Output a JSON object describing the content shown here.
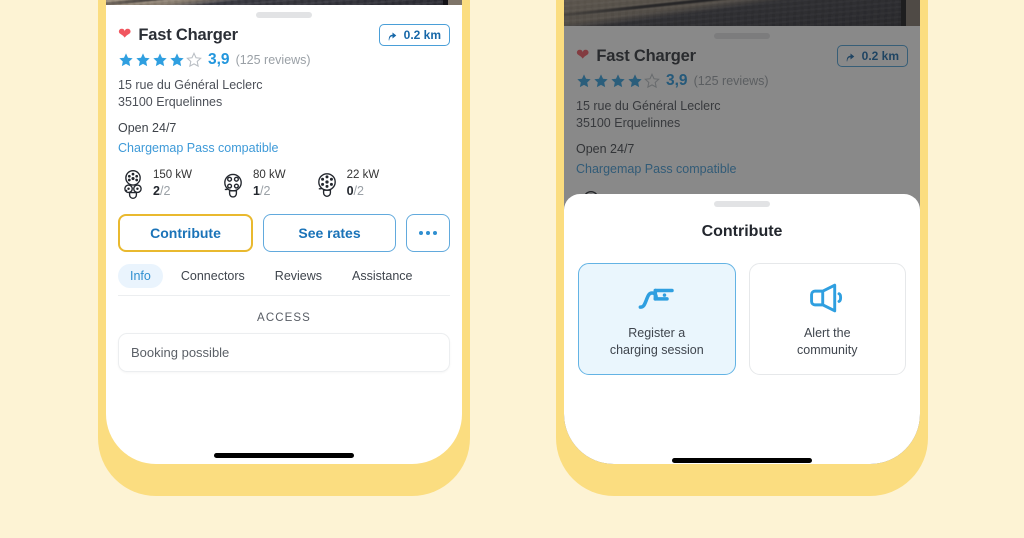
{
  "theme": {
    "page_bg": "#fdf3d4",
    "phone_frame": "#fbdd80",
    "accent_blue": "#2f8fd0",
    "accent_gold": "#e9b92f",
    "heart_red": "#f1565f",
    "star_filled": "#2f9fe0",
    "star_empty": "#b9bec4"
  },
  "poi": {
    "heart_icon": "heart-icon",
    "name": "Fast Charger",
    "distance_icon": "directions-arrow-icon",
    "distance": "0.2 km",
    "rating_value": "3,9",
    "rating_stars_filled": 4,
    "rating_stars_total": 5,
    "reviews": "(125 reviews)",
    "address_line1": "15 rue du Général Leclerc",
    "address_line2": "35100 Erquelinnes",
    "hours": "Open 24/7",
    "pass_link": "Chargemap Pass compatible",
    "connectors": [
      {
        "icon": "ccs-combo-plug-icon",
        "power": "150 kW",
        "available": "2",
        "total": "2"
      },
      {
        "icon": "chademo-plug-icon",
        "power": "80 kW",
        "available": "1",
        "total": "2"
      },
      {
        "icon": "type2-plug-icon",
        "power": "22 kW",
        "available": "0",
        "total": "2"
      }
    ]
  },
  "actions": {
    "contribute": "Contribute",
    "see_rates": "See rates",
    "more_icon": "more-ellipsis-icon"
  },
  "tabs": [
    {
      "label": "Info",
      "active": true
    },
    {
      "label": "Connectors",
      "active": false
    },
    {
      "label": "Reviews",
      "active": false
    },
    {
      "label": "Assistance",
      "active": false
    }
  ],
  "info_section": {
    "heading": "ACCESS",
    "row_text": "Booking possible"
  },
  "sheet": {
    "handle": "drag-handle",
    "title": "Contribute",
    "options": [
      {
        "icon": "charging-session-icon",
        "label": "Register a\ncharging session",
        "selected": true
      },
      {
        "icon": "megaphone-icon",
        "label": "Alert the\ncommunity",
        "selected": false
      }
    ]
  }
}
